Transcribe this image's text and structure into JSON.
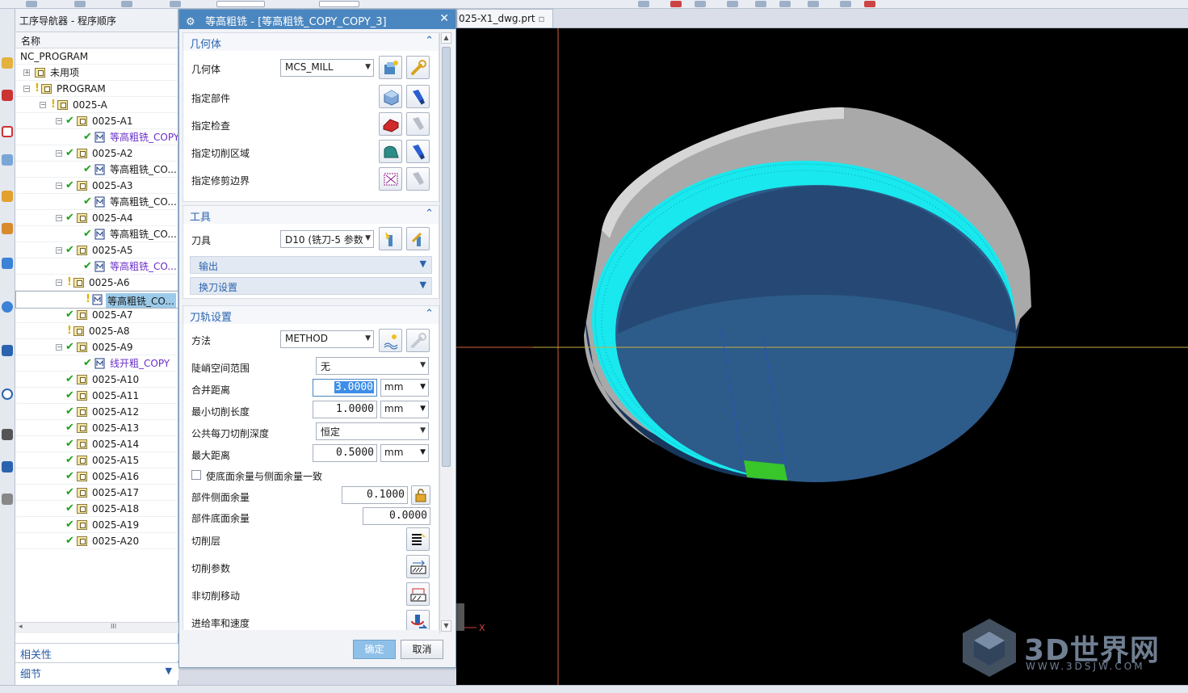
{
  "navigator": {
    "title": "工序导航器 - 程序顺序",
    "column_name": "名称",
    "rows": [
      {
        "label": "NC_PROGRAM",
        "indent": 0,
        "status": "none",
        "kind": "root"
      },
      {
        "label": "未用项",
        "indent": 1,
        "status": "none",
        "kind": "folder",
        "twist": "+"
      },
      {
        "label": "PROGRAM",
        "indent": 1,
        "status": "warn",
        "kind": "folder",
        "twist": "-"
      },
      {
        "label": "0025-A",
        "indent": 2,
        "status": "warn",
        "kind": "folder",
        "twist": "-"
      },
      {
        "label": "0025-A1",
        "indent": 3,
        "status": "ok",
        "kind": "folder",
        "twist": "-"
      },
      {
        "label": "等高粗铣_COPY",
        "indent": 4,
        "status": "ok",
        "kind": "op"
      },
      {
        "label": "0025-A2",
        "indent": 3,
        "status": "ok",
        "kind": "folder",
        "twist": "-"
      },
      {
        "label": "等高粗铣_CO...",
        "indent": 4,
        "status": "ok",
        "kind": "opdark"
      },
      {
        "label": "0025-A3",
        "indent": 3,
        "status": "ok",
        "kind": "folder",
        "twist": "-"
      },
      {
        "label": "等高粗铣_CO...",
        "indent": 4,
        "status": "ok",
        "kind": "opdark"
      },
      {
        "label": "0025-A4",
        "indent": 3,
        "status": "ok",
        "kind": "folder",
        "twist": "-"
      },
      {
        "label": "等高粗铣_CO...",
        "indent": 4,
        "status": "ok",
        "kind": "opdark"
      },
      {
        "label": "0025-A5",
        "indent": 3,
        "status": "ok",
        "kind": "folder",
        "twist": "-"
      },
      {
        "label": "等高粗铣_CO...",
        "indent": 4,
        "status": "ok",
        "kind": "op"
      },
      {
        "label": "0025-A6",
        "indent": 3,
        "status": "warn",
        "kind": "folder",
        "twist": "-"
      },
      {
        "label": "等高粗铣_CO...",
        "indent": 4,
        "status": "warn",
        "kind": "opsel"
      },
      {
        "label": "0025-A7",
        "indent": 3,
        "status": "ok",
        "kind": "folder"
      },
      {
        "label": "0025-A8",
        "indent": 3,
        "status": "warn",
        "kind": "folder"
      },
      {
        "label": "0025-A9",
        "indent": 3,
        "status": "ok",
        "kind": "folder",
        "twist": "-"
      },
      {
        "label": "线开粗_COPY",
        "indent": 4,
        "status": "ok",
        "kind": "op"
      },
      {
        "label": "0025-A10",
        "indent": 3,
        "status": "ok",
        "kind": "folder"
      },
      {
        "label": "0025-A11",
        "indent": 3,
        "status": "ok",
        "kind": "folder"
      },
      {
        "label": "0025-A12",
        "indent": 3,
        "status": "ok",
        "kind": "folder"
      },
      {
        "label": "0025-A13",
        "indent": 3,
        "status": "ok",
        "kind": "folder"
      },
      {
        "label": "0025-A14",
        "indent": 3,
        "status": "ok",
        "kind": "folder"
      },
      {
        "label": "0025-A15",
        "indent": 3,
        "status": "ok",
        "kind": "folder"
      },
      {
        "label": "0025-A16",
        "indent": 3,
        "status": "ok",
        "kind": "folder"
      },
      {
        "label": "0025-A17",
        "indent": 3,
        "status": "ok",
        "kind": "folder"
      },
      {
        "label": "0025-A18",
        "indent": 3,
        "status": "ok",
        "kind": "folder"
      },
      {
        "label": "0025-A19",
        "indent": 3,
        "status": "ok",
        "kind": "folder"
      },
      {
        "label": "0025-A20",
        "indent": 3,
        "status": "ok",
        "kind": "folder"
      }
    ],
    "scroll_grip": "III",
    "section_dependencies": "相关性",
    "section_details": "细节"
  },
  "dialog": {
    "title": "等高粗铣 - [等高粗铣_COPY_COPY_3]",
    "close": "✕",
    "geometry": {
      "header": "几何体",
      "geometry_label": "几何体",
      "geometry_value": "MCS_MILL",
      "specify_part": "指定部件",
      "specify_check": "指定检查",
      "specify_cut_area": "指定切削区域",
      "specify_trim_boundary": "指定修剪边界"
    },
    "tool": {
      "header": "工具",
      "tool_label": "刀具",
      "tool_value": "D10 (铣刀-5 参数",
      "output": "输出",
      "tool_change": "换刀设置"
    },
    "path": {
      "header": "刀轨设置",
      "method_label": "方法",
      "method_value": "METHOD",
      "steep_label": "陡峭空间范围",
      "steep_value": "无",
      "merge_label": "合并距离",
      "merge_value": "3.0000",
      "merge_unit": "mm",
      "min_cut_label": "最小切削长度",
      "min_cut_value": "1.0000",
      "min_cut_unit": "mm",
      "depth_label": "公共每刀切削深度",
      "depth_value": "恒定",
      "max_dist_label": "最大距离",
      "max_dist_value": "0.5000",
      "max_dist_unit": "mm",
      "floor_same_label": "使底面余量与侧面余量一致",
      "side_stock_label": "部件侧面余量",
      "side_stock_value": "0.1000",
      "floor_stock_label": "部件底面余量",
      "floor_stock_value": "0.0000",
      "cut_levels": "切削层",
      "cut_params": "切削参数",
      "non_cut_moves": "非切削移动",
      "feeds_speeds": "进给率和速度"
    },
    "ok": "确定",
    "cancel": "取消"
  },
  "graphics": {
    "doc_tab": "025-X1_dwg.prt",
    "axis_x": "X"
  },
  "watermark": {
    "brand": "3D世界网",
    "url": "WWW.3DSJW.COM"
  },
  "colors": {
    "title_bar": "#4a86bf",
    "section_header": "#2a64b0",
    "selection": "#9ccbea",
    "check_green": "#1ea01e",
    "warn_yellow": "#e0b000",
    "op_purple": "#6a2fc8"
  }
}
